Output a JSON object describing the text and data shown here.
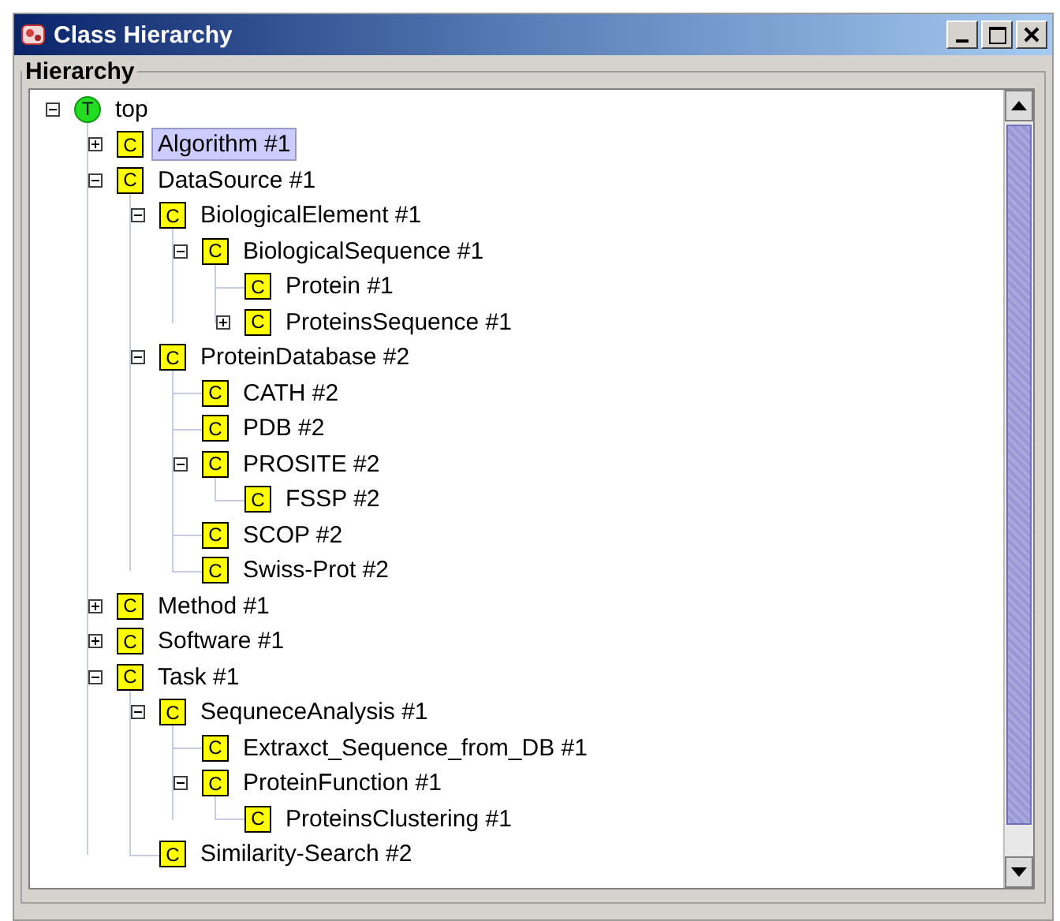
{
  "window": {
    "title": "Class Hierarchy"
  },
  "group": {
    "label": "Hierarchy"
  },
  "tree": [
    {
      "label": "top",
      "badge": "T",
      "kind": "top",
      "expanded": true,
      "selected": false,
      "children": [
        {
          "label": "Algorithm #1",
          "badge": "C",
          "kind": "class",
          "expanded": false,
          "selected": true
        },
        {
          "label": "DataSource #1",
          "badge": "C",
          "kind": "class",
          "expanded": true,
          "selected": false,
          "children": [
            {
              "label": "BiologicalElement #1",
              "badge": "C",
              "kind": "class",
              "expanded": true,
              "selected": false,
              "children": [
                {
                  "label": "BiologicalSequence #1",
                  "badge": "C",
                  "kind": "class",
                  "expanded": true,
                  "selected": false,
                  "children": [
                    {
                      "label": "Protein #1",
                      "badge": "C",
                      "kind": "class",
                      "selected": false
                    },
                    {
                      "label": "ProteinsSequence #1",
                      "badge": "C",
                      "kind": "class",
                      "expanded": false,
                      "selected": false
                    }
                  ]
                }
              ]
            },
            {
              "label": "ProteinDatabase #2",
              "badge": "C",
              "kind": "class",
              "expanded": true,
              "selected": false,
              "children": [
                {
                  "label": "CATH #2",
                  "badge": "C",
                  "kind": "class",
                  "selected": false
                },
                {
                  "label": "PDB #2",
                  "badge": "C",
                  "kind": "class",
                  "selected": false
                },
                {
                  "label": "PROSITE #2",
                  "badge": "C",
                  "kind": "class",
                  "expanded": true,
                  "selected": false,
                  "children": [
                    {
                      "label": "FSSP #2",
                      "badge": "C",
                      "kind": "class",
                      "selected": false
                    }
                  ]
                },
                {
                  "label": "SCOP #2",
                  "badge": "C",
                  "kind": "class",
                  "selected": false
                },
                {
                  "label": "Swiss-Prot #2",
                  "badge": "C",
                  "kind": "class",
                  "selected": false
                }
              ]
            }
          ]
        },
        {
          "label": "Method #1",
          "badge": "C",
          "kind": "class",
          "expanded": false,
          "selected": false
        },
        {
          "label": "Software #1",
          "badge": "C",
          "kind": "class",
          "expanded": false,
          "selected": false
        },
        {
          "label": "Task #1",
          "badge": "C",
          "kind": "class",
          "expanded": true,
          "selected": false,
          "children": [
            {
              "label": "SequneceAnalysis #1",
              "badge": "C",
              "kind": "class",
              "expanded": true,
              "selected": false,
              "children": [
                {
                  "label": "Extraxct_Sequence_from_DB #1",
                  "badge": "C",
                  "kind": "class",
                  "selected": false
                },
                {
                  "label": "ProteinFunction #1",
                  "badge": "C",
                  "kind": "class",
                  "expanded": true,
                  "selected": false,
                  "children": [
                    {
                      "label": "ProteinsClustering #1",
                      "badge": "C",
                      "kind": "class",
                      "selected": false
                    }
                  ]
                }
              ]
            },
            {
              "label": "Similarity-Search #2",
              "badge": "C",
              "kind": "class",
              "selected": false
            }
          ]
        }
      ]
    }
  ]
}
